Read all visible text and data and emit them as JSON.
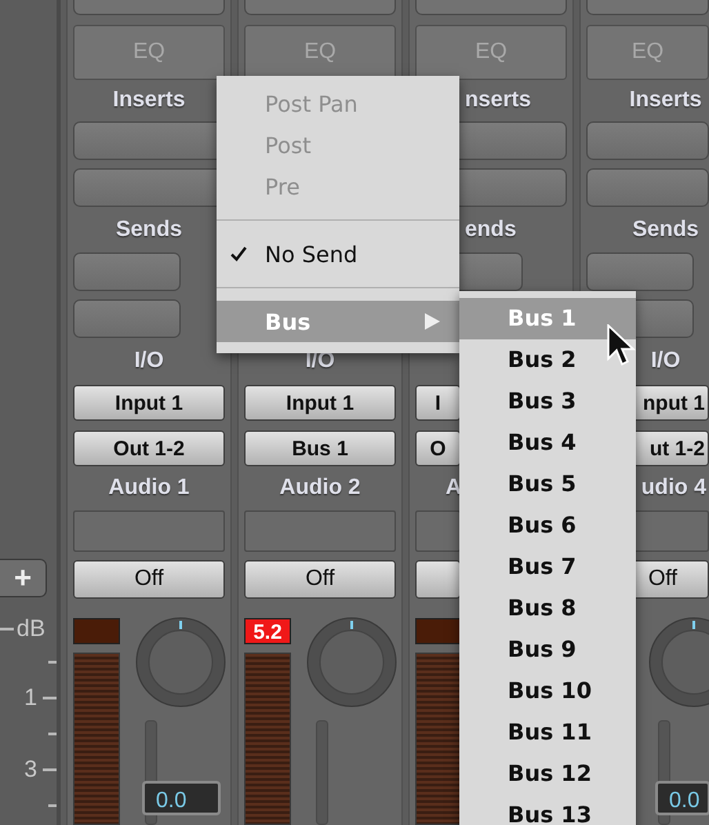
{
  "ruler": {
    "add_button": "+",
    "unit": "dB",
    "labels": [
      "1",
      "3"
    ]
  },
  "channels": [
    {
      "eq": "EQ",
      "inserts_label": "Inserts",
      "sends_label": "Sends",
      "io_label": "I/O",
      "input": "Input 1",
      "output": "Out 1-2",
      "name": "Audio 1",
      "automation": "Off",
      "clipped": false,
      "value": "0.0"
    },
    {
      "eq": "EQ",
      "io_label": "I/O",
      "input": "Input 1",
      "output": "Bus 1",
      "name": "Audio 2",
      "automation": "Off",
      "peak": "5.2",
      "clipped": true
    },
    {
      "eq": "EQ",
      "inserts_label": "nserts",
      "sends_label": "ends",
      "input": "I",
      "output": "O",
      "name": "A",
      "clipped": false
    },
    {
      "eq": "EQ",
      "inserts_label": "Inserts",
      "sends_label": "Sends",
      "io_label": "I/O",
      "input": "nput 1",
      "output": "ut 1-2",
      "name": "udio 4",
      "automation": "Off",
      "value": "0.0"
    }
  ],
  "menu": {
    "items": [
      {
        "kind": "item",
        "label": "Post Pan",
        "disabled": true,
        "checked": false,
        "selected": false
      },
      {
        "kind": "item",
        "label": "Post",
        "disabled": true,
        "checked": false,
        "selected": false
      },
      {
        "kind": "item",
        "label": "Pre",
        "disabled": true,
        "checked": false,
        "selected": false
      },
      {
        "kind": "separator"
      },
      {
        "kind": "item",
        "label": "No Send",
        "disabled": false,
        "checked": true,
        "selected": false
      },
      {
        "kind": "separator"
      },
      {
        "kind": "submenu",
        "label": "Bus",
        "disabled": false,
        "checked": false,
        "selected": true
      }
    ]
  },
  "submenu": {
    "items": [
      {
        "label": "Bus 1",
        "selected": true
      },
      {
        "label": "Bus 2",
        "selected": false
      },
      {
        "label": "Bus 3",
        "selected": false
      },
      {
        "label": "Bus 4",
        "selected": false
      },
      {
        "label": "Bus 5",
        "selected": false
      },
      {
        "label": "Bus 6",
        "selected": false
      },
      {
        "label": "Bus 7",
        "selected": false
      },
      {
        "label": "Bus 8",
        "selected": false
      },
      {
        "label": "Bus 9",
        "selected": false
      },
      {
        "label": "Bus 10",
        "selected": false
      },
      {
        "label": "Bus 11",
        "selected": false
      },
      {
        "label": "Bus 12",
        "selected": false
      },
      {
        "label": "Bus 13",
        "selected": false
      }
    ]
  }
}
